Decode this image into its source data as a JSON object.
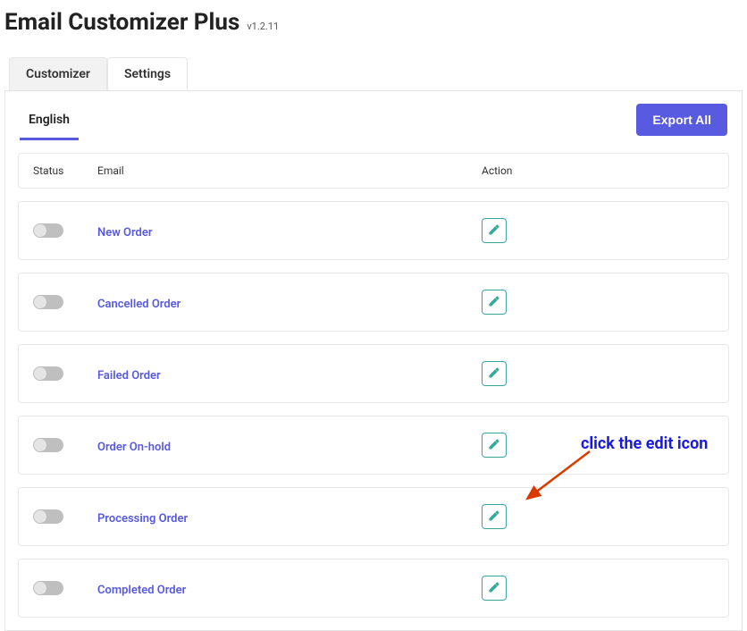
{
  "header": {
    "title": "Email Customizer Plus",
    "version": "v1.2.11"
  },
  "tabs": {
    "customizer": "Customizer",
    "settings": "Settings"
  },
  "language_tab": "English",
  "export_button": "Export All",
  "columns": {
    "status": "Status",
    "email": "Email",
    "action": "Action"
  },
  "emails": [
    {
      "name": "New Order"
    },
    {
      "name": "Cancelled Order"
    },
    {
      "name": "Failed Order"
    },
    {
      "name": "Order On-hold"
    },
    {
      "name": "Processing Order"
    },
    {
      "name": "Completed Order"
    }
  ],
  "annotation": "click the edit icon"
}
